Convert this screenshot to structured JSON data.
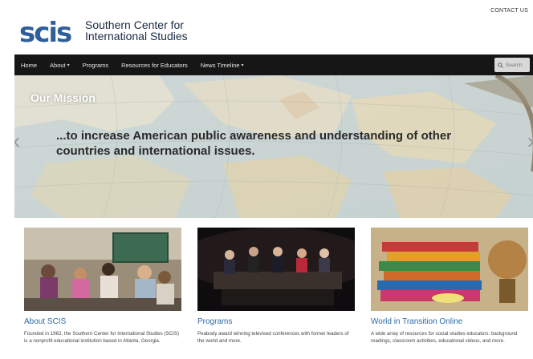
{
  "header": {
    "contact_label": "CONTACT US",
    "logo_mark": "SCIS",
    "logo_line1": "Southern Center for",
    "logo_line2": "International Studies"
  },
  "nav": {
    "items": [
      {
        "label": "Home"
      },
      {
        "label": "About",
        "dropdown": true
      },
      {
        "label": "Programs"
      },
      {
        "label": "Resources for Educators"
      },
      {
        "label": "News Timeline",
        "dropdown": true
      }
    ],
    "search_placeholder": "Search"
  },
  "hero": {
    "heading": "Our Mission",
    "text": "...to increase American public awareness and understanding of other countries and international issues."
  },
  "columns": [
    {
      "title": "About SCIS",
      "text": "Founded in 1962, the Southern Center for International Studies (SCIS) is a nonprofit educational institution based in Atlanta, Georgia."
    },
    {
      "title": "Programs",
      "text": "Peabody award winning televised conferences with former leaders of the world and more."
    },
    {
      "title": "World in Transition Online",
      "text": "A wide array of resources for social studies educators: background readings, classroom activities, educational videos, and more."
    }
  ],
  "colors": {
    "nav_bg": "#161616",
    "link_blue": "#2b6aa6",
    "logo_blue": "#2f5f9a"
  }
}
